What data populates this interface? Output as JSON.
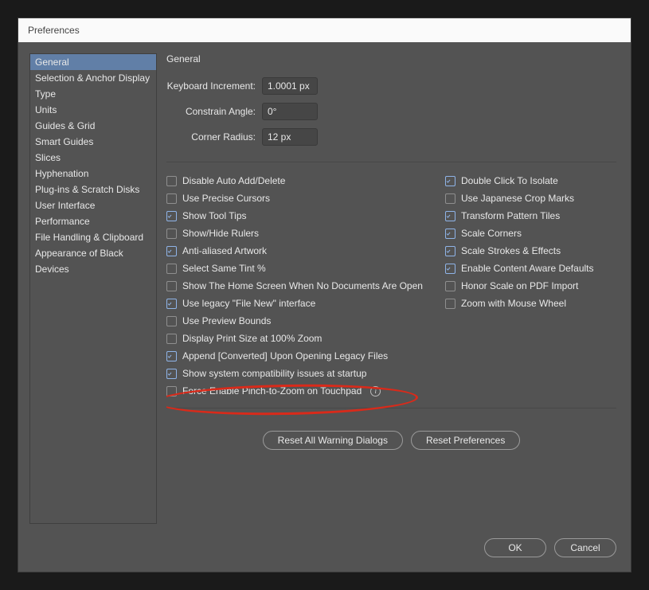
{
  "window": {
    "title": "Preferences"
  },
  "sidebar": {
    "items": [
      "General",
      "Selection & Anchor Display",
      "Type",
      "Units",
      "Guides & Grid",
      "Smart Guides",
      "Slices",
      "Hyphenation",
      "Plug-ins & Scratch Disks",
      "User Interface",
      "Performance",
      "File Handling & Clipboard",
      "Appearance of Black",
      "Devices"
    ],
    "active_index": 0
  },
  "panel": {
    "title": "General",
    "fields": {
      "keyboard_increment": {
        "label": "Keyboard Increment:",
        "value": "1.0001 px"
      },
      "constrain_angle": {
        "label": "Constrain Angle:",
        "value": "0°"
      },
      "corner_radius": {
        "label": "Corner Radius:",
        "value": "12 px"
      }
    },
    "checks_left": [
      {
        "label": "Disable Auto Add/Delete",
        "checked": false
      },
      {
        "label": "Use Precise Cursors",
        "checked": false
      },
      {
        "label": "Show Tool Tips",
        "checked": true
      },
      {
        "label": "Show/Hide Rulers",
        "checked": false
      },
      {
        "label": "Anti-aliased Artwork",
        "checked": true
      },
      {
        "label": "Select Same Tint %",
        "checked": false
      },
      {
        "label": "Show The Home Screen When No Documents Are Open",
        "checked": false
      },
      {
        "label": "Use legacy \"File New\" interface",
        "checked": true
      },
      {
        "label": "Use Preview Bounds",
        "checked": false
      },
      {
        "label": "Display Print Size at 100% Zoom",
        "checked": false
      },
      {
        "label": "Append [Converted] Upon Opening Legacy Files",
        "checked": true
      },
      {
        "label": "Show system compatibility issues at startup",
        "checked": true
      },
      {
        "label": "Force Enable Pinch-to-Zoom on Touchpad",
        "checked": false,
        "info": true
      }
    ],
    "checks_right": [
      {
        "label": "Double Click To Isolate",
        "checked": true
      },
      {
        "label": "Use Japanese Crop Marks",
        "checked": false
      },
      {
        "label": "Transform Pattern Tiles",
        "checked": true
      },
      {
        "label": "Scale Corners",
        "checked": true
      },
      {
        "label": "Scale Strokes & Effects",
        "checked": true
      },
      {
        "label": "Enable Content Aware Defaults",
        "checked": true
      },
      {
        "label": "Honor Scale on PDF Import",
        "checked": false
      },
      {
        "label": "Zoom with Mouse Wheel",
        "checked": false
      }
    ],
    "buttons": {
      "reset_warnings": "Reset All Warning Dialogs",
      "reset_prefs": "Reset Preferences"
    }
  },
  "footer": {
    "ok": "OK",
    "cancel": "Cancel"
  }
}
